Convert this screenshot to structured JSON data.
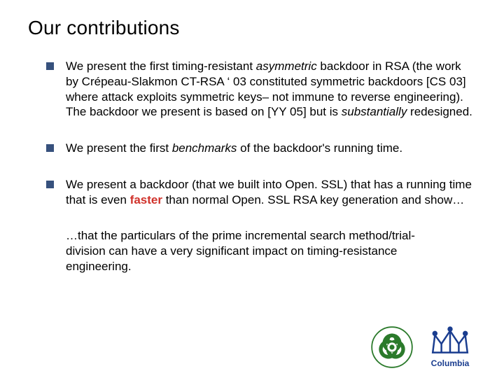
{
  "title": "Our contributions",
  "bullets": [
    {
      "pre": "We present the first timing-resistant ",
      "em1": "asymmetric",
      "mid": " backdoor in RSA (the work by Crépeau-Slakmon CT-RSA ‘ 03 constituted symmetric backdoors [CS 03] where attack exploits symmetric keys– not immune to reverse engineering). The backdoor we present is based on [YY 05] but is ",
      "em2": "substantially",
      "post": " redesigned."
    },
    {
      "pre": "We present the first ",
      "em1": "benchmarks",
      "mid": " of the backdoor's running time.",
      "em2": "",
      "post": ""
    },
    {
      "pre": "We present a backdoor (that we built into Open. SSL) that has a running time that is even ",
      "red": "faster",
      "post": " than normal Open. SSL RSA key generation and show…"
    }
  ],
  "closing": "…that the particulars of the prime incremental search method/trial-division can have a very significant impact on timing-resistance engineering.",
  "columbia_label": "Columbia"
}
